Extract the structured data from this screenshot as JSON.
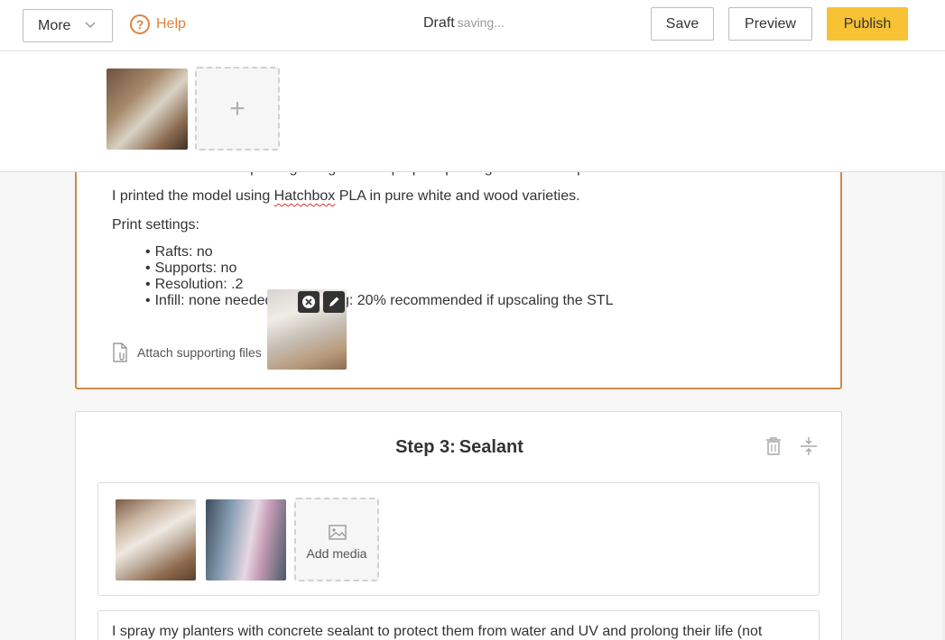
{
  "toolbar": {
    "more_label": "More",
    "help_label": "Help",
    "help_glyph": "?",
    "status_label": "Draft",
    "status_detail": "saving...",
    "save_label": "Save",
    "preview_label": "Preview",
    "publish_label": "Publish"
  },
  "media_strip": {
    "add_glyph": "+"
  },
  "step2": {
    "cut_line": "I sliced the model for printing using Cura to prep for printing on the Monoprice Ultimate Pro.",
    "line_model": "I printed the model using ",
    "line_model_brand": "Hatchbox",
    "line_model_rest": " PLA in pure white and wood varieties.",
    "print_settings": "Print settings:",
    "bullets": [
      "Rafts: no",
      "Supports: no",
      "Resolution: .2",
      "Infill: none needed if upscaling: 20% recommended if upscaling the STL"
    ],
    "attach_label": "Attach supporting files"
  },
  "step3": {
    "step_number": "Step 3:",
    "step_title": "Sealant",
    "add_media_label": "Add media",
    "body_text": "I spray my planters with concrete sealant to protect them from water and UV and prolong their life (not"
  },
  "colors": {
    "accent": "#f8c235",
    "help": "#e0823c",
    "active_border": "#d08a45"
  },
  "icons": [
    "chevron-down-icon",
    "help-icon",
    "plus-icon",
    "file-attach-icon",
    "close-icon",
    "pencil-icon",
    "trash-icon",
    "collapse-icon",
    "image-icon"
  ]
}
